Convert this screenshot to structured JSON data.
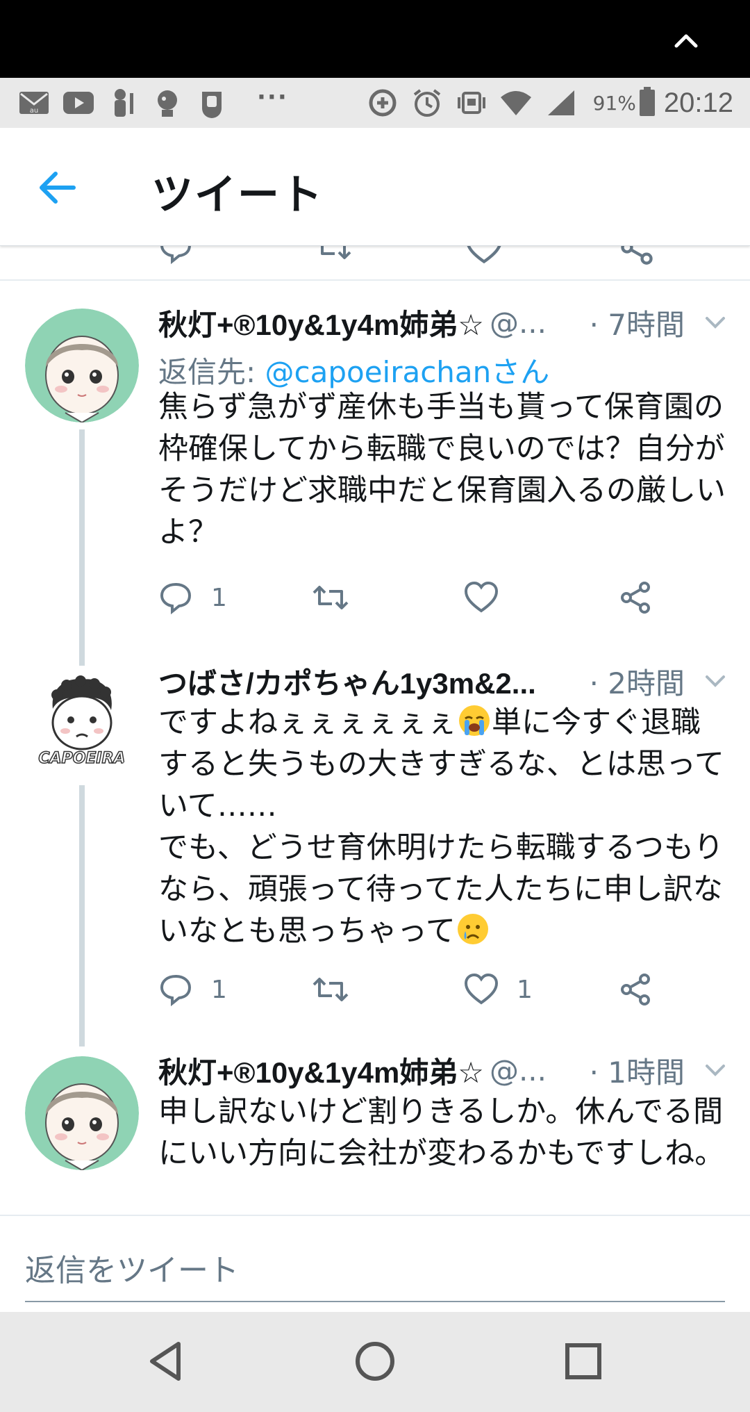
{
  "header": {
    "title": "ツイート"
  },
  "status_bar": {
    "battery": "91%",
    "time": "20:12",
    "more": "···",
    "left_icons": [
      "mail-icon",
      "youtube-icon",
      "app-icon-1",
      "app-icon-2",
      "app-icon-3"
    ],
    "right_icons": [
      "data-saver-icon",
      "alarm-icon",
      "vibrate-icon",
      "wifi-icon",
      "signal-icon",
      "battery-icon"
    ]
  },
  "tweets": [
    {
      "name": "秋灯+®10y&1y4m姉弟☆",
      "handle": "@...",
      "time": "· 7時間",
      "reply_prefix": "返信先: ",
      "reply_to": "@capoeirachanさん",
      "text": "焦らず急がず産休も手当も貰って保育園の枠確保してから転職で良いのでは？自分がそうだけど求職中だと保育園入るの厳しいよ？",
      "replies": "1",
      "retweets": "",
      "likes": ""
    },
    {
      "name": "つばさ/カポちゃん1y3m&2...",
      "handle": "",
      "time": "· 2時間",
      "text_a": "ですよねぇぇぇぇぇぇ",
      "text_b": "単に今すぐ退職すると失うもの大きすぎるな、とは思っていて……\nでも、どうせ育休明けたら転職するつもりなら、頑張って待ってた人たちに申し訳ないなとも思っちゃって",
      "avatar_text": "CAPOEIRA",
      "replies": "1",
      "retweets": "",
      "likes": "1"
    },
    {
      "name": "秋灯+®10y&1y4m姉弟☆",
      "handle": "@...",
      "time": "· 1時間",
      "text": "申し訳ないけど割りきるしか。休んでる間にいい方向に会社が変わるかもですしね。"
    }
  ],
  "compose": {
    "placeholder": "返信をツイート"
  },
  "colors": {
    "accent": "#1da1f2",
    "muted": "#657786",
    "avatar_bg": "#8fd3b4"
  }
}
